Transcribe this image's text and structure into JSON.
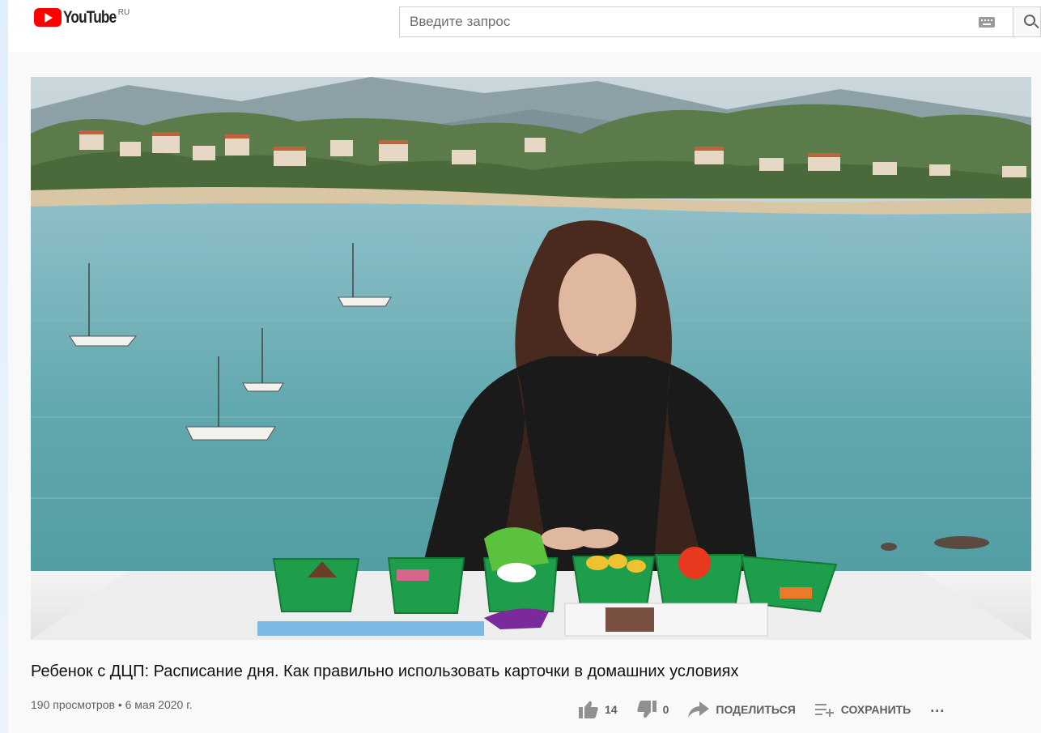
{
  "header": {
    "logo_text": "YouTube",
    "logo_region": "RU",
    "search_placeholder": "Введите запрос",
    "keyboard_icon": "keyboard-icon",
    "search_icon": "search-icon"
  },
  "video": {
    "title": "Ребенок с ДЦП: Расписание дня. Как правильно использовать карточки в домашних условиях",
    "views": "190 просмотров",
    "separator": "•",
    "date": "6 мая 2020 г."
  },
  "actions": {
    "likes": "14",
    "dislikes": "0",
    "share_label": "ПОДЕЛИТЬСЯ",
    "save_label": "СОХРАНИТЬ",
    "more_label": "..."
  },
  "colors": {
    "brand_red": "#ff0000",
    "text_primary": "#111111",
    "text_secondary": "#606060"
  }
}
